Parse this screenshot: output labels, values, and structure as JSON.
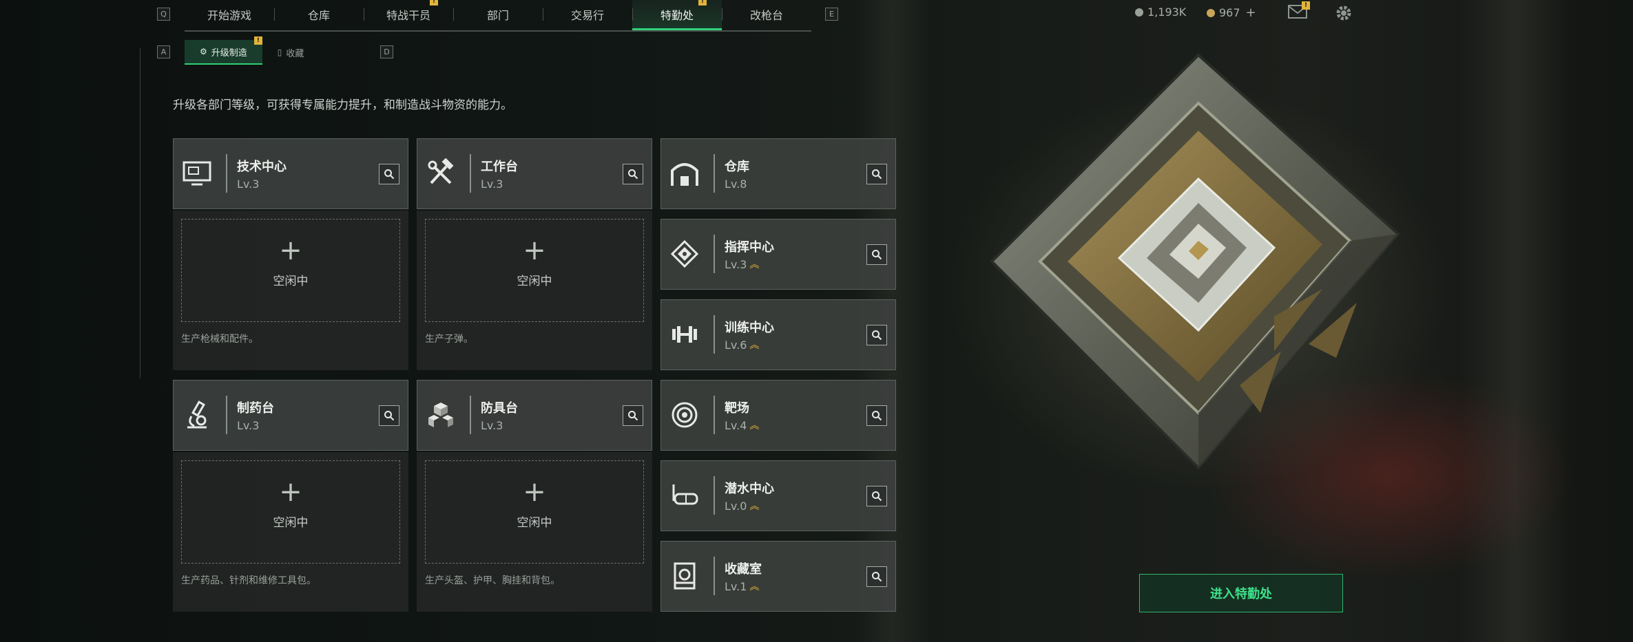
{
  "nav": {
    "key_left": "Q",
    "key_right": "E",
    "tabs": [
      {
        "label": "开始游戏"
      },
      {
        "label": "仓库"
      },
      {
        "label": "特战干员",
        "badge": "!"
      },
      {
        "label": "部门"
      },
      {
        "label": "交易行"
      },
      {
        "label": "特勤处",
        "badge": "!",
        "active": true
      },
      {
        "label": "改枪台"
      }
    ]
  },
  "resources": {
    "currency1": "1,193K",
    "currency2": "967",
    "add": "+",
    "mail_badge": "!"
  },
  "subnav": {
    "key_left": "A",
    "key_right": "D",
    "tabs": [
      {
        "label": "升级制造",
        "badge": "!",
        "active": true
      },
      {
        "label": "收藏"
      }
    ]
  },
  "intro": "升级各部门等级，可获得专属能力提升，和制造战斗物资的能力。",
  "production": [
    {
      "name": "技术中心",
      "level": "Lv.3",
      "icon": "computer-icon",
      "slot": {
        "plus": "+",
        "status": "空闲中",
        "desc": "生产枪械和配件。"
      }
    },
    {
      "name": "工作台",
      "level": "Lv.3",
      "icon": "tools-icon",
      "slot": {
        "plus": "+",
        "status": "空闲中",
        "desc": "生产子弹。"
      }
    },
    {
      "name": "制药台",
      "level": "Lv.3",
      "icon": "microscope-icon",
      "slot": {
        "plus": "+",
        "status": "空闲中",
        "desc": "生产药品、针剂和维修工具包。"
      }
    },
    {
      "name": "防具台",
      "level": "Lv.3",
      "icon": "cubes-icon",
      "slot": {
        "plus": "+",
        "status": "空闲中",
        "desc": "生产头盔、护甲、胸挂和背包。"
      }
    }
  ],
  "facilities": [
    {
      "name": "仓库",
      "level": "Lv.8",
      "icon": "warehouse-icon",
      "upgradable": false
    },
    {
      "name": "指挥中心",
      "level": "Lv.3",
      "icon": "chip-icon",
      "upgradable": true
    },
    {
      "name": "训练中心",
      "level": "Lv.6",
      "icon": "dumbbell-icon",
      "upgradable": true
    },
    {
      "name": "靶场",
      "level": "Lv.4",
      "icon": "target-icon",
      "upgradable": true
    },
    {
      "name": "潜水中心",
      "level": "Lv.0",
      "icon": "diving-mask-icon",
      "upgradable": true
    },
    {
      "name": "收藏室",
      "level": "Lv.1",
      "icon": "collection-icon",
      "upgradable": true
    }
  ],
  "upgrade_glyph": "︽",
  "enter_button": "进入特勤处",
  "colors": {
    "accent": "#2fd17a",
    "badge": "#e2b43b",
    "upgrade": "#e5b53b"
  }
}
